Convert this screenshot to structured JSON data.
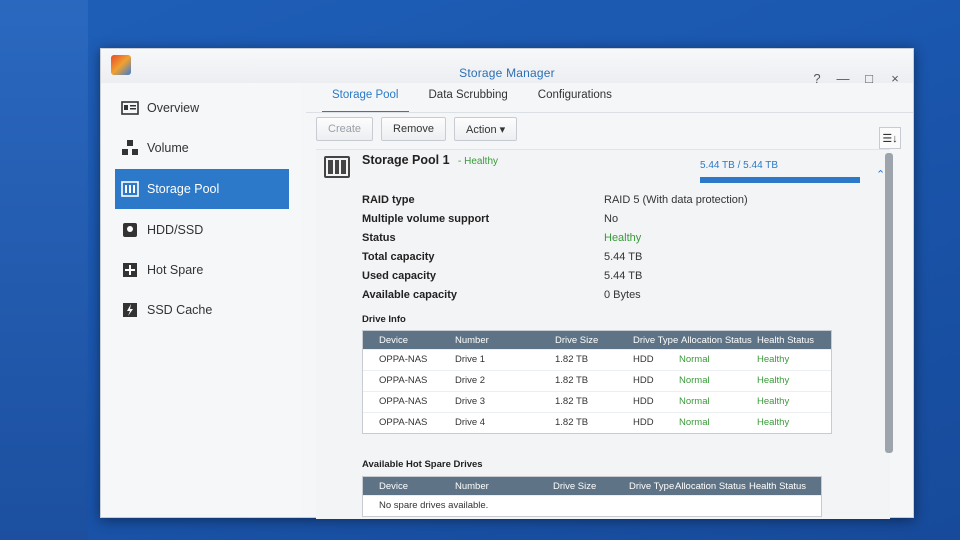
{
  "window": {
    "title": "Storage Manager",
    "controls": [
      "?",
      "—",
      "□",
      "×"
    ]
  },
  "sidebar": {
    "items": [
      {
        "label": "Overview",
        "icon": "overview-icon"
      },
      {
        "label": "Volume",
        "icon": "volume-icon"
      },
      {
        "label": "Storage Pool",
        "icon": "storage-pool-icon",
        "active": true
      },
      {
        "label": "HDD/SSD",
        "icon": "hdd-icon"
      },
      {
        "label": "Hot Spare",
        "icon": "hot-spare-icon"
      },
      {
        "label": "SSD Cache",
        "icon": "ssd-cache-icon"
      }
    ]
  },
  "tabs": [
    "Storage Pool",
    "Data Scrubbing",
    "Configurations"
  ],
  "toolbar": {
    "create": "Create",
    "remove": "Remove",
    "action": "Action ▾",
    "sort_icon": "☰↓"
  },
  "pool": {
    "name": "Storage Pool 1",
    "health": "- Healthy",
    "capacity_text": "5.44 TB / 5.44 TB",
    "capacity_fraction": 1.0,
    "collapse_glyph": "⌃",
    "details": [
      {
        "key": "RAID type",
        "value": "RAID 5 (With data protection)"
      },
      {
        "key": "Multiple volume support",
        "value": "No"
      },
      {
        "key": "Status",
        "value": "Healthy"
      },
      {
        "key": "Total capacity",
        "value": "5.44 TB"
      },
      {
        "key": "Used capacity",
        "value": "5.44 TB"
      },
      {
        "key": "Available capacity",
        "value": "0 Bytes"
      }
    ]
  },
  "drive_info": {
    "heading": "Drive Info",
    "columns": [
      "Device",
      "Number",
      "Drive Size",
      "Drive Type",
      "Allocation Status",
      "Health Status"
    ],
    "rows": [
      [
        "OPPA-NAS",
        "Drive 1",
        "1.82 TB",
        "HDD",
        "Normal",
        "Healthy"
      ],
      [
        "OPPA-NAS",
        "Drive 2",
        "1.82 TB",
        "HDD",
        "Normal",
        "Healthy"
      ],
      [
        "OPPA-NAS",
        "Drive 3",
        "1.82 TB",
        "HDD",
        "Normal",
        "Healthy"
      ],
      [
        "OPPA-NAS",
        "Drive 4",
        "1.82 TB",
        "HDD",
        "Normal",
        "Healthy"
      ]
    ]
  },
  "hot_spare": {
    "heading": "Available Hot Spare Drives",
    "columns": [
      "Device",
      "Number",
      "Drive Size",
      "Drive Type",
      "Allocation Status",
      "Health Status"
    ],
    "empty_text": "No spare drives available."
  },
  "colors": {
    "accent": "#2b79c8",
    "healthy": "#3a9a3a",
    "grid_header": "#5e7385"
  }
}
